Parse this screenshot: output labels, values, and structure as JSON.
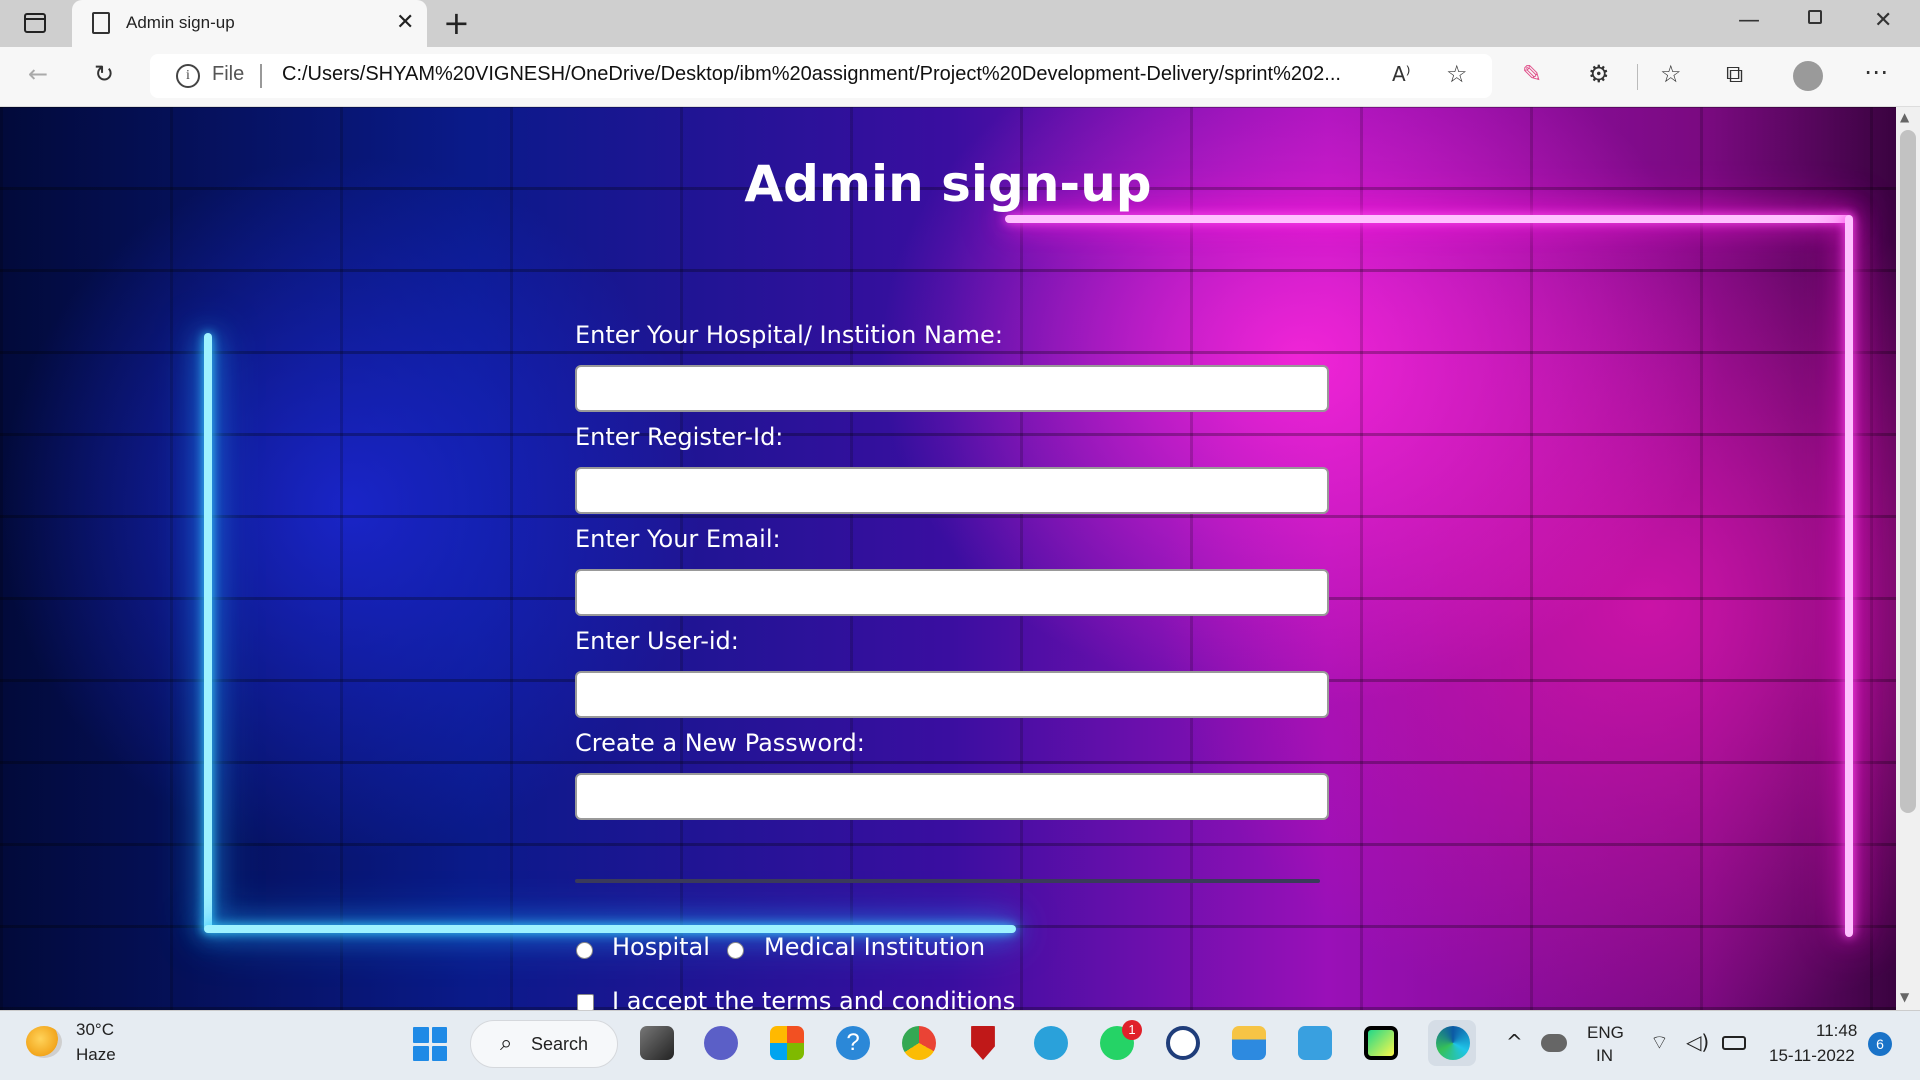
{
  "browser": {
    "tab_title": "Admin sign-up",
    "file_label": "File",
    "url": "C:/Users/SHYAM%20VIGNESH/OneDrive/Desktop/ibm%20assignment/Project%20Development-Delivery/sprint%202..."
  },
  "page": {
    "title": "Admin sign-up",
    "fields": [
      {
        "label": "Enter Your Hospital/ Instition Name:",
        "value": ""
      },
      {
        "label": "Enter Register-Id:",
        "value": ""
      },
      {
        "label": "Enter Your Email:",
        "value": ""
      },
      {
        "label": "Enter User-id:",
        "value": ""
      },
      {
        "label": "Create a New Password:",
        "value": ""
      }
    ],
    "radio_options": [
      "Hospital",
      "Medical Institution"
    ],
    "terms_label": "I accept the terms and conditions"
  },
  "taskbar": {
    "temperature": "30°C",
    "weather": "Haze",
    "search_label": "Search",
    "whatsapp_badge": "1",
    "lang_line1": "ENG",
    "lang_line2": "IN",
    "time": "11:48",
    "date": "15-11-2022",
    "notification_count": "6"
  }
}
